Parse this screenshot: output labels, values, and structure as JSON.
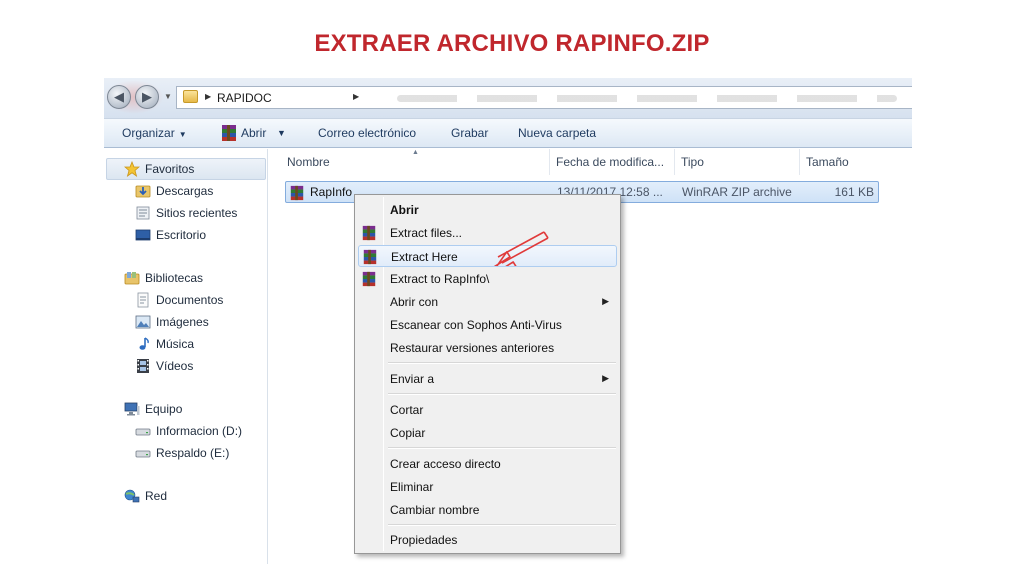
{
  "slide": {
    "title": "EXTRAER ARCHIVO RAPINFO.ZIP"
  },
  "address": {
    "current_folder": "RAPIDOC"
  },
  "toolbar": {
    "organizar": "Organizar",
    "abrir": "Abrir",
    "correo": "Correo electrónico",
    "grabar": "Grabar",
    "nueva_carpeta": "Nueva carpeta"
  },
  "navigation": {
    "favoritos": "Favoritos",
    "favorites_items": [
      "Descargas",
      "Sitios recientes",
      "Escritorio"
    ],
    "bibliotecas": "Bibliotecas",
    "library_items": [
      "Documentos",
      "Imágenes",
      "Música",
      "Vídeos"
    ],
    "equipo": "Equipo",
    "computer_items": [
      "Informacion (D:)",
      "Respaldo (E:)"
    ],
    "red": "Red"
  },
  "filelist": {
    "columns": {
      "name": "Nombre",
      "date": "Fecha de modifica...",
      "type": "Tipo",
      "size": "Tamaño"
    },
    "rows": [
      {
        "name": "RapInfo",
        "date": "13/11/2017 12:58 ...",
        "type": "WinRAR ZIP archive",
        "size": "161 KB"
      }
    ]
  },
  "context_menu": {
    "items": [
      "Abrir",
      "Extract files...",
      "Extract Here",
      "Extract to RapInfo\\",
      "Abrir con",
      "Escanear con Sophos Anti-Virus",
      "Restaurar versiones anteriores",
      "Enviar a",
      "Cortar",
      "Copiar",
      "Crear acceso directo",
      "Eliminar",
      "Cambiar nombre",
      "Propiedades"
    ],
    "highlighted": "Extract Here"
  },
  "colors": {
    "title_red": "#c0272d",
    "annotation_arrow": "#e03a3a",
    "selection_blue": "#cfe2f7",
    "toolbar_text": "#1e3a5f"
  }
}
